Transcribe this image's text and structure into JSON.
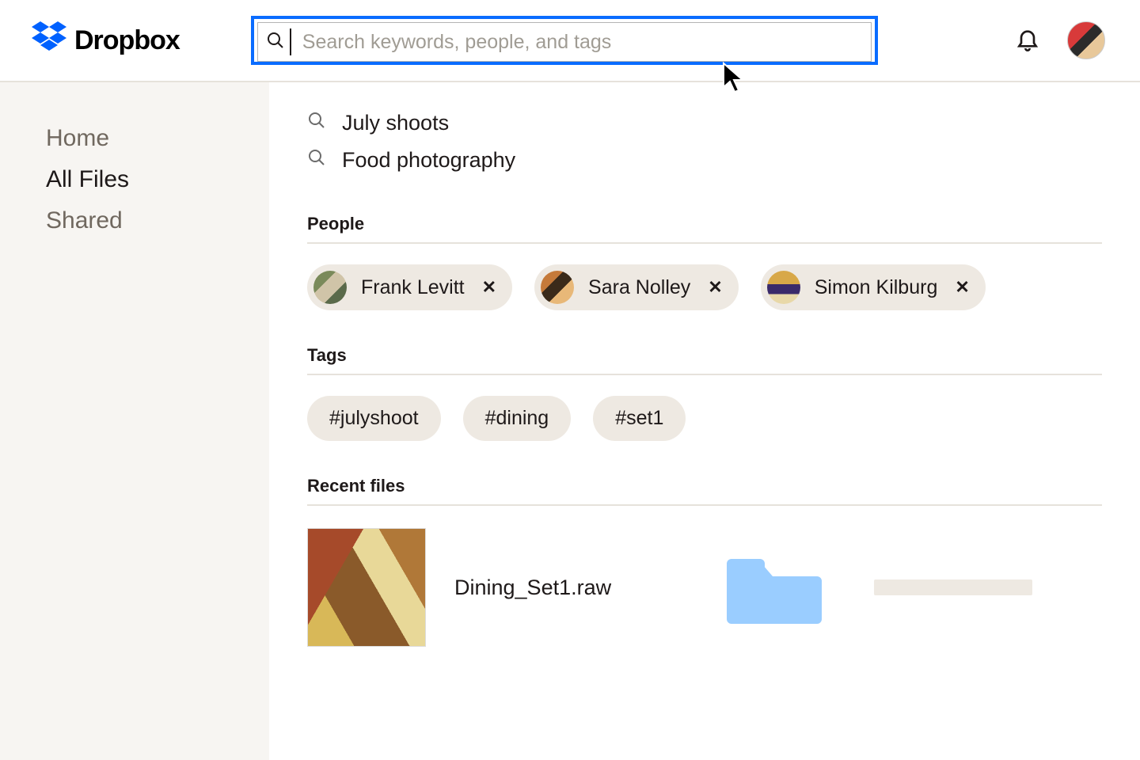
{
  "header": {
    "brand": "Dropbox",
    "search_placeholder": "Search keywords, people, and tags"
  },
  "sidebar": {
    "items": [
      {
        "label": "Home",
        "active": false
      },
      {
        "label": "All Files",
        "active": true
      },
      {
        "label": "Shared",
        "active": false
      }
    ]
  },
  "suggestions": [
    "July shoots",
    "Food photography"
  ],
  "people": {
    "heading": "People",
    "items": [
      {
        "name": "Frank Levitt"
      },
      {
        "name": "Sara Nolley"
      },
      {
        "name": "Simon Kilburg"
      }
    ]
  },
  "tags": {
    "heading": "Tags",
    "items": [
      "#julyshoot",
      "#dining",
      "#set1"
    ]
  },
  "recent": {
    "heading": "Recent files",
    "file_name": "Dining_Set1.raw"
  }
}
